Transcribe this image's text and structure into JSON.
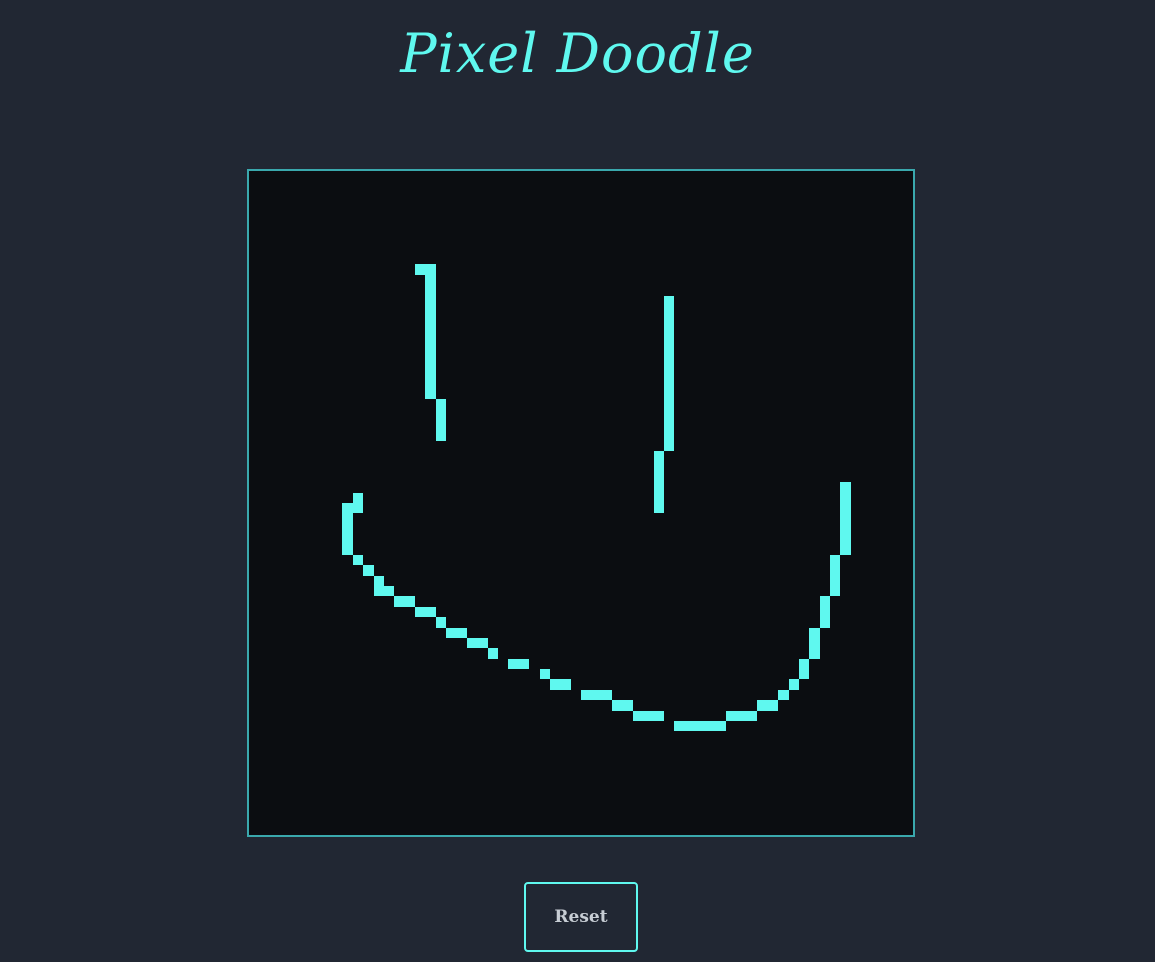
{
  "page": {
    "title": "Pixel Doodle",
    "reset_label": "Reset"
  },
  "colors": {
    "background": "#212733",
    "accent": "#5ff8ef",
    "board_background": "#0b0d11",
    "board_border": "#3aa8ad"
  },
  "grid": {
    "columns": 64,
    "rows": 64,
    "painted_color": "#5ff8ef",
    "painted_cells": [
      [
        16,
        9
      ],
      [
        17,
        9
      ],
      [
        17,
        10
      ],
      [
        17,
        11
      ],
      [
        17,
        12
      ],
      [
        17,
        13
      ],
      [
        17,
        14
      ],
      [
        17,
        15
      ],
      [
        17,
        16
      ],
      [
        17,
        17
      ],
      [
        17,
        18
      ],
      [
        17,
        19
      ],
      [
        17,
        20
      ],
      [
        17,
        21
      ],
      [
        18,
        22
      ],
      [
        18,
        23
      ],
      [
        18,
        24
      ],
      [
        18,
        25
      ],
      [
        40,
        12
      ],
      [
        40,
        13
      ],
      [
        40,
        14
      ],
      [
        40,
        15
      ],
      [
        40,
        16
      ],
      [
        40,
        17
      ],
      [
        40,
        18
      ],
      [
        40,
        19
      ],
      [
        40,
        20
      ],
      [
        40,
        21
      ],
      [
        40,
        22
      ],
      [
        40,
        23
      ],
      [
        40,
        24
      ],
      [
        40,
        25
      ],
      [
        40,
        26
      ],
      [
        39,
        27
      ],
      [
        39,
        28
      ],
      [
        39,
        29
      ],
      [
        39,
        30
      ],
      [
        39,
        31
      ],
      [
        39,
        32
      ],
      [
        10,
        31
      ],
      [
        9,
        32
      ],
      [
        10,
        32
      ],
      [
        9,
        33
      ],
      [
        9,
        34
      ],
      [
        9,
        35
      ],
      [
        9,
        36
      ],
      [
        10,
        37
      ],
      [
        11,
        38
      ],
      [
        12,
        39
      ],
      [
        12,
        40
      ],
      [
        13,
        40
      ],
      [
        14,
        41
      ],
      [
        15,
        41
      ],
      [
        16,
        42
      ],
      [
        17,
        42
      ],
      [
        18,
        43
      ],
      [
        19,
        44
      ],
      [
        20,
        44
      ],
      [
        21,
        45
      ],
      [
        22,
        45
      ],
      [
        23,
        46
      ],
      [
        25,
        47
      ],
      [
        26,
        47
      ],
      [
        28,
        48
      ],
      [
        29,
        49
      ],
      [
        30,
        49
      ],
      [
        32,
        50
      ],
      [
        33,
        50
      ],
      [
        34,
        50
      ],
      [
        35,
        51
      ],
      [
        36,
        51
      ],
      [
        37,
        52
      ],
      [
        38,
        52
      ],
      [
        39,
        52
      ],
      [
        41,
        53
      ],
      [
        42,
        53
      ],
      [
        43,
        53
      ],
      [
        44,
        53
      ],
      [
        45,
        53
      ],
      [
        46,
        52
      ],
      [
        47,
        52
      ],
      [
        48,
        52
      ],
      [
        49,
        51
      ],
      [
        50,
        51
      ],
      [
        51,
        50
      ],
      [
        52,
        49
      ],
      [
        53,
        48
      ],
      [
        53,
        47
      ],
      [
        54,
        46
      ],
      [
        54,
        45
      ],
      [
        54,
        44
      ],
      [
        55,
        43
      ],
      [
        55,
        42
      ],
      [
        55,
        41
      ],
      [
        56,
        40
      ],
      [
        56,
        39
      ],
      [
        56,
        38
      ],
      [
        56,
        37
      ],
      [
        57,
        36
      ],
      [
        57,
        35
      ],
      [
        57,
        34
      ],
      [
        57,
        33
      ],
      [
        57,
        32
      ],
      [
        57,
        31
      ],
      [
        57,
        30
      ]
    ]
  }
}
